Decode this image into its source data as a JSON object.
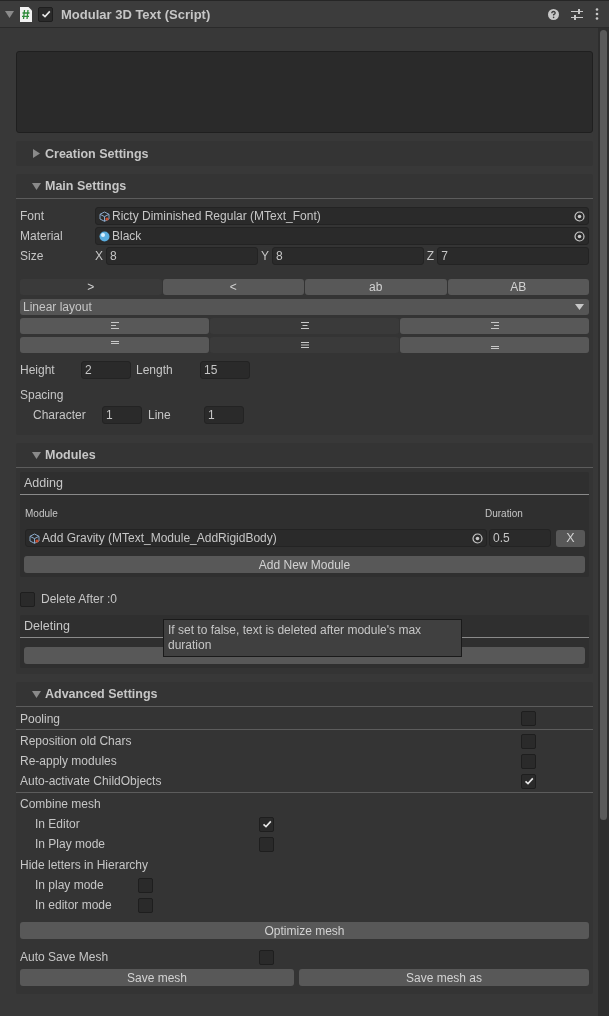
{
  "component": {
    "title": "Modular 3D Text (Script)",
    "expanded": true,
    "enabled": true
  },
  "creation_settings": {
    "title": "Creation Settings",
    "expanded": false
  },
  "main_settings": {
    "title": "Main Settings",
    "expanded": true,
    "font": {
      "label": "Font",
      "value": "Ricty Diminished Regular (MText_Font)"
    },
    "material": {
      "label": "Material",
      "value": "Black"
    },
    "size": {
      "label": "Size",
      "axes": [
        {
          "axis": "X",
          "value": "8"
        },
        {
          "axis": "Y",
          "value": "8"
        },
        {
          "axis": "Z",
          "value": "7"
        }
      ]
    },
    "toggles": [
      {
        "label": ">",
        "selected": true
      },
      {
        "label": "<",
        "selected": false
      },
      {
        "label": "ab",
        "selected": false
      },
      {
        "label": "AB",
        "selected": false
      }
    ],
    "layout_dropdown": {
      "value": "Linear layout"
    },
    "alignment_rows": [
      {
        "buttons": [
          {
            "kind": "left",
            "selected": false
          },
          {
            "kind": "center",
            "selected": true
          },
          {
            "kind": "right",
            "selected": false
          }
        ]
      },
      {
        "buttons": [
          {
            "kind": "top",
            "selected": false
          },
          {
            "kind": "middle",
            "selected": true
          },
          {
            "kind": "bottom",
            "selected": false
          }
        ]
      }
    ],
    "height": {
      "label": "Height",
      "value": "2"
    },
    "length": {
      "label": "Length",
      "value": "15"
    },
    "spacing": {
      "label": "Spacing",
      "character": {
        "label": "Character",
        "value": "1"
      },
      "line": {
        "label": "Line",
        "value": "1"
      }
    }
  },
  "modules": {
    "title": "Modules",
    "expanded": true,
    "adding": {
      "title": "Adding",
      "module_column": "Module",
      "duration_column": "Duration",
      "rows": [
        {
          "module": "Add Gravity (MText_Module_AddRigidBody)",
          "duration": "0.5",
          "remove": "X"
        }
      ],
      "add_button": "Add New Module"
    },
    "delete_after": {
      "label": "Delete After :0",
      "checked": false
    },
    "deleting": {
      "title": "Deleting"
    },
    "tooltip": "If set to false, text is deleted after module's max duration"
  },
  "advanced_settings": {
    "title": "Advanced Settings",
    "expanded": true,
    "pooling": {
      "label": "Pooling",
      "checked": false
    },
    "options": [
      {
        "label": "Reposition old Chars",
        "checked": false
      },
      {
        "label": "Re-apply modules",
        "checked": false
      },
      {
        "label": "Auto-activate ChildObjects",
        "checked": true
      }
    ],
    "combine_mesh": {
      "label": "Combine mesh",
      "options": [
        {
          "label": "In Editor",
          "checked": true
        },
        {
          "label": "In Play mode",
          "checked": false
        }
      ]
    },
    "hide_letters": {
      "label": "Hide letters in Hierarchy",
      "options": [
        {
          "label": "In play mode",
          "checked": false
        },
        {
          "label": "In editor mode",
          "checked": false
        }
      ]
    },
    "optimize_button": "Optimize mesh",
    "auto_save": {
      "label": "Auto Save Mesh",
      "checked": false
    },
    "save_buttons": [
      "Save mesh",
      "Save mesh as"
    ]
  }
}
